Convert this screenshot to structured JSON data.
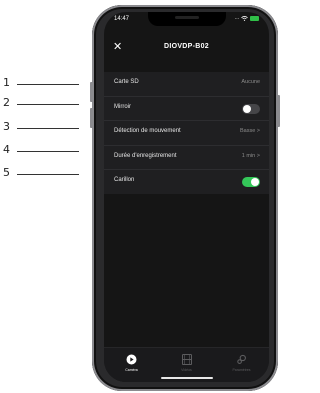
{
  "callouts": [
    "1",
    "2",
    "3",
    "4",
    "5"
  ],
  "status_bar": {
    "time": "14:47",
    "signal": "...",
    "wifi_icon": "wifi-icon",
    "battery": "battery-icon"
  },
  "header": {
    "close_glyph": "✕",
    "title": "DIOVDP-B02"
  },
  "settings": [
    {
      "label": "Carte SD",
      "value": "Aucune",
      "control": "text"
    },
    {
      "label": "Mirroir",
      "value": "",
      "control": "toggle",
      "state": false
    },
    {
      "label": "Détection de mouvement",
      "value": "Basse >",
      "control": "text"
    },
    {
      "label": "Durée d'enregistrement",
      "value": "1 min >",
      "control": "text"
    },
    {
      "label": "Carillon",
      "value": "",
      "control": "toggle",
      "state": true
    }
  ],
  "tabs": [
    {
      "label": "Caméra",
      "icon": "camera-icon",
      "active": true
    },
    {
      "label": "Vidéos",
      "icon": "film-icon",
      "active": false
    },
    {
      "label": "Paramètres",
      "icon": "settings-icon",
      "active": false
    }
  ],
  "colors": {
    "accent_green": "#34c759",
    "background": "#151515",
    "row_bg": "#1f1f21"
  }
}
